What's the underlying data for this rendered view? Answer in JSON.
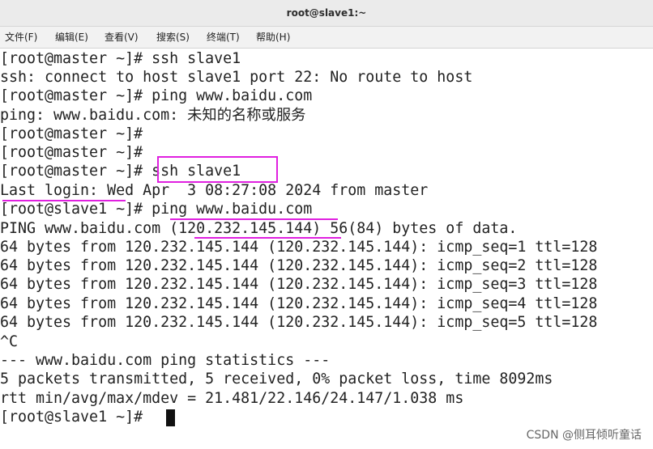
{
  "window": {
    "title": "root@slave1:~"
  },
  "menu": [
    {
      "label": "文件(F)"
    },
    {
      "label": "编辑(E)"
    },
    {
      "label": "查看(V)"
    },
    {
      "label": "搜索(S)"
    },
    {
      "label": "终端(T)"
    },
    {
      "label": "帮助(H)"
    }
  ],
  "terminal": {
    "lines": [
      "[root@master ~]# ssh slave1",
      "ssh: connect to host slave1 port 22: No route to host",
      "[root@master ~]# ping www.baidu.com",
      "ping: www.baidu.com: 未知的名称或服务",
      "[root@master ~]#",
      "[root@master ~]#",
      "[root@master ~]# ssh slave1",
      "Last login: Wed Apr  3 08:27:08 2024 from master",
      "[root@slave1 ~]# ping www.baidu.com",
      "PING www.baidu.com (120.232.145.144) 56(84) bytes of data.",
      "64 bytes from 120.232.145.144 (120.232.145.144): icmp_seq=1 ttl=128",
      "64 bytes from 120.232.145.144 (120.232.145.144): icmp_seq=2 ttl=128",
      "64 bytes from 120.232.145.144 (120.232.145.144): icmp_seq=3 ttl=128",
      "64 bytes from 120.232.145.144 (120.232.145.144): icmp_seq=4 ttl=128",
      "64 bytes from 120.232.145.144 (120.232.145.144): icmp_seq=5 ttl=128",
      "^C",
      "--- www.baidu.com ping statistics ---",
      "5 packets transmitted, 5 received, 0% packet loss, time 8092ms",
      "rtt min/avg/max/mdev = 21.481/22.146/24.147/1.038 ms",
      "[root@slave1 ~]# "
    ]
  },
  "watermark": "CSDN @侧耳倾听童话",
  "colors": {
    "highlight": "#e020e0",
    "text": "#222222",
    "background": "#ffffff"
  }
}
